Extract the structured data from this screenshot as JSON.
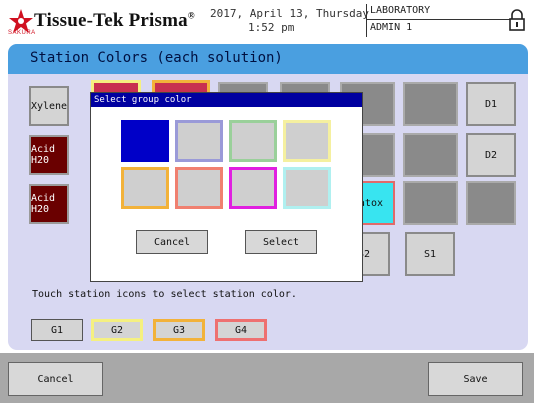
{
  "header": {
    "brand": "Tissue-Tek Prisma",
    "brand_mark": "®",
    "sub_brand": "SAKURA",
    "date_line": "2017, April 13, Thursday",
    "time_line": "1:52 pm",
    "location": "LABORATORY",
    "user": "ADMIN 1",
    "logo_icon": "sakura-star-icon",
    "lock_icon": "padlock-icon"
  },
  "panel": {
    "title": "Station Colors (each solution)",
    "instruction": "Touch station icons to select station color.",
    "stations": [
      {
        "label": "Xylene",
        "style": "light"
      },
      {
        "label": "Acid H20",
        "style": "red"
      },
      {
        "label": "Acid H20",
        "style": "red"
      },
      {
        "label": "atox",
        "style": "cyan"
      },
      {
        "label": "S2",
        "style": "light"
      },
      {
        "label": "S1",
        "style": "light"
      },
      {
        "label": "D1",
        "style": "light"
      },
      {
        "label": "D2",
        "style": "light"
      }
    ],
    "groups": [
      {
        "label": "G1",
        "color": "#555555"
      },
      {
        "label": "G2",
        "color": "#f5f080"
      },
      {
        "label": "G3",
        "color": "#f2b23a"
      },
      {
        "label": "G4",
        "color": "#ee7070"
      }
    ]
  },
  "dialog": {
    "title": "Select group color",
    "swatch_borders": [
      "#0000c8",
      "#9a9ad8",
      "#9ad09a",
      "#f5f0a0",
      "#f2b23a",
      "#f08070",
      "#e020e0",
      "#b0f0f0"
    ],
    "selected_swatch": "#0000c8",
    "cancel": "Cancel",
    "select": "Select"
  },
  "footer": {
    "cancel": "Cancel",
    "save": "Save"
  },
  "colors": {
    "panel_bg": "#d8d8f2",
    "panel_header": "#4a9fe0",
    "dialog_title_bg": "#0000a0",
    "footer_bg": "#a8a8a8",
    "brand_red": "#d01020"
  }
}
